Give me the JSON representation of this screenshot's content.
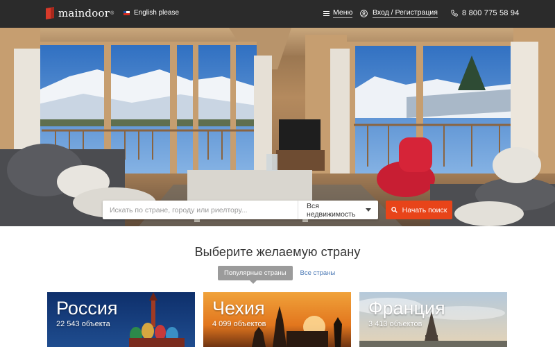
{
  "header": {
    "logo_text": "maindoor",
    "logo_reg": "®",
    "language_label": "English please",
    "menu_label": "Меню",
    "login_label": "Вход / Регистрация",
    "phone": "8 800 775 58 94"
  },
  "search": {
    "placeholder": "Искать по стране, городу или риелтору...",
    "property_type": "Вся недвижимость",
    "button_label": "Начать поиск"
  },
  "countries": {
    "title": "Выберите желаемую страну",
    "tabs": [
      "Популярные страны",
      "Все страны"
    ],
    "cards": [
      {
        "name": "Россия",
        "count": "22 543 объекта"
      },
      {
        "name": "Чехия",
        "count": "4 099 объектов"
      },
      {
        "name": "Франция",
        "count": "3 413 объектов"
      }
    ]
  },
  "colors": {
    "header_bg": "#2b2b2b",
    "brand_red": "#d93a2a",
    "search_button": "#e84419",
    "tab_active_bg": "#9b9b9b",
    "tab_link": "#4b79b5"
  }
}
